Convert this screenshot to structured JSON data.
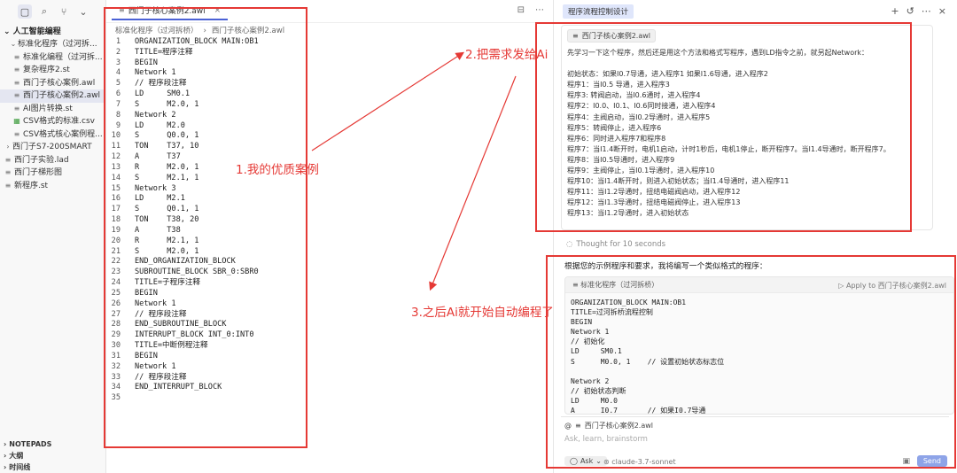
{
  "sidebar": {
    "root_label": "人工智能编程",
    "items": [
      {
        "label": "标准化程序（过河拆...",
        "type": "folder",
        "open": true
      },
      {
        "label": "标准化编程（过河拆...",
        "type": "file"
      },
      {
        "label": "复杂程序2.st",
        "type": "file"
      },
      {
        "label": "西门子核心案例.awl",
        "type": "file"
      },
      {
        "label": "西门子核心案例2.awl",
        "type": "file",
        "selected": true
      },
      {
        "label": "AI图片转换.st",
        "type": "file"
      },
      {
        "label": "CSV格式的标准.csv",
        "type": "csv"
      },
      {
        "label": "CSV格式核心案例程...",
        "type": "file"
      },
      {
        "label": "西门子S7-200SMART",
        "type": "folder",
        "open": false
      },
      {
        "label": "西门子实验.lad",
        "type": "file"
      },
      {
        "label": "西门子梯形图",
        "type": "file"
      },
      {
        "label": "新程序.st",
        "type": "file"
      }
    ],
    "bottom_sections": [
      "NOTEPADS",
      "大纲",
      "时间线"
    ]
  },
  "editor": {
    "tab_label": "西门子核心案例2.awl",
    "breadcrumb": [
      "标准化程序（过河拆桥）",
      "西门子核心案例2.awl"
    ],
    "code_lines": [
      "ORGANIZATION_BLOCK MAIN:OB1",
      "TITLE=程序注释",
      "BEGIN",
      "Network 1",
      "// 程序段注释",
      "LD     SM0.1",
      "S      M2.0, 1",
      "Network 2",
      "LD     M2.0",
      "S      Q0.0, 1",
      "TON    T37, 10",
      "A      T37",
      "R      M2.0, 1",
      "S      M2.1, 1",
      "Network 3",
      "LD     M2.1",
      "S      Q0.1, 1",
      "TON    T38, 20",
      "A      T38",
      "R      M2.1, 1",
      "S      M2.0, 1",
      "END_ORGANIZATION_BLOCK",
      "SUBROUTINE_BLOCK SBR_0:SBR0",
      "TITLE=子程序注释",
      "BEGIN",
      "Network 1",
      "// 程序段注释",
      "END_SUBROUTINE_BLOCK",
      "INTERRUPT_BLOCK INT_0:INT0",
      "TITLE=中断例程注释",
      "BEGIN",
      "Network 1",
      "// 程序段注释",
      "END_INTERRUPT_BLOCK",
      ""
    ]
  },
  "chat": {
    "title": "程序流程控制设计",
    "user_attachment": "西门子核心案例2.awl",
    "user_lines": [
      "先学习一下这个程序，然后还是用这个方法和格式写程序，遇到LD指令之前，就另起Network：",
      "",
      "初始状态：如果I0.7导通，进入程序1 如果I1.6导通，进入程序2",
      "程序1：当I0.5 导通，进入程序3",
      "程序3: 转阀启动，当I0.6通时，进入程序4",
      "程序2：I0.0、I0.1、I0.6同时接通，进入程序4",
      "程序4：主阀启动，当I0.2导通时，进入程序5",
      "程序5：转阀停止，进入程序6",
      "程序6：同时进入程序7和程序8",
      "程序7：当I1.4断开时，电机1启动，计时1秒后，电机1停止，断开程序7。当I1.4导通时，断开程序7。",
      "程序8：当I0.5导通时，进入程序9",
      "程序9：主阀停止，当I0.1导通时，进入程序10",
      "程序10：当I1.4断开时，则进入初始状态；当I1.4导通时，进入程序11",
      "程序11：当I1.2导通时，扭结电磁阀启动，进入程序12",
      "程序12：当I1.3导通时，扭结电磁阀停止，进入程序13",
      "程序13：当I1.2导通时，进入初始状态"
    ],
    "thought_label": "Thought for 10 seconds",
    "answer_intro": "根据您的示例程序和要求，我将编写一个类似格式的程序：",
    "codeblock": {
      "file_label": "标准化程序（过河拆桥）",
      "apply_label": "Apply to 西门子核心案例2.awl",
      "lines": [
        "ORGANIZATION_BLOCK MAIN:OB1",
        "TITLE=过河拆桥流程控制",
        "BEGIN",
        "Network 1",
        "// 初始化",
        "LD     SM0.1",
        "S      M0.0, 1    // 设置初始状态标志位",
        "",
        "Network 2",
        "// 初始状态判断",
        "LD     M0.0",
        "A      I0.7       // 如果I0.7导通"
      ]
    },
    "input": {
      "attachment": "西门子核心案例2.awl",
      "placeholder": "Ask, learn, brainstorm",
      "mode": "Ask",
      "model": "claude-3.7-sonnet",
      "send_label": "Send"
    }
  },
  "annotations": {
    "label1": "1.我的优质案例",
    "label2": "2.把需求发给Ai",
    "label3": "3.之后Ai就开始自动编程了"
  },
  "colors": {
    "annotation_red": "#e53935",
    "accent_blue": "#4b62d6",
    "send_button": "#8ea4e8"
  }
}
